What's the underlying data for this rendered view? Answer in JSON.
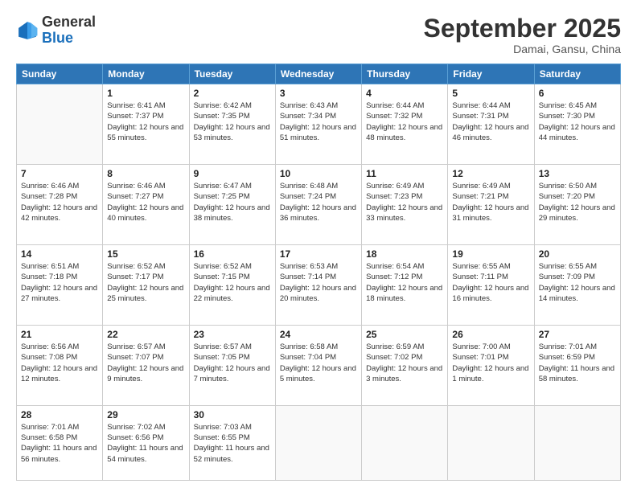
{
  "header": {
    "logo_general": "General",
    "logo_blue": "Blue",
    "month_title": "September 2025",
    "location": "Damai, Gansu, China"
  },
  "days_of_week": [
    "Sunday",
    "Monday",
    "Tuesday",
    "Wednesday",
    "Thursday",
    "Friday",
    "Saturday"
  ],
  "weeks": [
    [
      {
        "day": "",
        "empty": true
      },
      {
        "day": "1",
        "sunrise": "Sunrise: 6:41 AM",
        "sunset": "Sunset: 7:37 PM",
        "daylight": "Daylight: 12 hours and 55 minutes."
      },
      {
        "day": "2",
        "sunrise": "Sunrise: 6:42 AM",
        "sunset": "Sunset: 7:35 PM",
        "daylight": "Daylight: 12 hours and 53 minutes."
      },
      {
        "day": "3",
        "sunrise": "Sunrise: 6:43 AM",
        "sunset": "Sunset: 7:34 PM",
        "daylight": "Daylight: 12 hours and 51 minutes."
      },
      {
        "day": "4",
        "sunrise": "Sunrise: 6:44 AM",
        "sunset": "Sunset: 7:32 PM",
        "daylight": "Daylight: 12 hours and 48 minutes."
      },
      {
        "day": "5",
        "sunrise": "Sunrise: 6:44 AM",
        "sunset": "Sunset: 7:31 PM",
        "daylight": "Daylight: 12 hours and 46 minutes."
      },
      {
        "day": "6",
        "sunrise": "Sunrise: 6:45 AM",
        "sunset": "Sunset: 7:30 PM",
        "daylight": "Daylight: 12 hours and 44 minutes."
      }
    ],
    [
      {
        "day": "7",
        "sunrise": "Sunrise: 6:46 AM",
        "sunset": "Sunset: 7:28 PM",
        "daylight": "Daylight: 12 hours and 42 minutes."
      },
      {
        "day": "8",
        "sunrise": "Sunrise: 6:46 AM",
        "sunset": "Sunset: 7:27 PM",
        "daylight": "Daylight: 12 hours and 40 minutes."
      },
      {
        "day": "9",
        "sunrise": "Sunrise: 6:47 AM",
        "sunset": "Sunset: 7:25 PM",
        "daylight": "Daylight: 12 hours and 38 minutes."
      },
      {
        "day": "10",
        "sunrise": "Sunrise: 6:48 AM",
        "sunset": "Sunset: 7:24 PM",
        "daylight": "Daylight: 12 hours and 36 minutes."
      },
      {
        "day": "11",
        "sunrise": "Sunrise: 6:49 AM",
        "sunset": "Sunset: 7:23 PM",
        "daylight": "Daylight: 12 hours and 33 minutes."
      },
      {
        "day": "12",
        "sunrise": "Sunrise: 6:49 AM",
        "sunset": "Sunset: 7:21 PM",
        "daylight": "Daylight: 12 hours and 31 minutes."
      },
      {
        "day": "13",
        "sunrise": "Sunrise: 6:50 AM",
        "sunset": "Sunset: 7:20 PM",
        "daylight": "Daylight: 12 hours and 29 minutes."
      }
    ],
    [
      {
        "day": "14",
        "sunrise": "Sunrise: 6:51 AM",
        "sunset": "Sunset: 7:18 PM",
        "daylight": "Daylight: 12 hours and 27 minutes."
      },
      {
        "day": "15",
        "sunrise": "Sunrise: 6:52 AM",
        "sunset": "Sunset: 7:17 PM",
        "daylight": "Daylight: 12 hours and 25 minutes."
      },
      {
        "day": "16",
        "sunrise": "Sunrise: 6:52 AM",
        "sunset": "Sunset: 7:15 PM",
        "daylight": "Daylight: 12 hours and 22 minutes."
      },
      {
        "day": "17",
        "sunrise": "Sunrise: 6:53 AM",
        "sunset": "Sunset: 7:14 PM",
        "daylight": "Daylight: 12 hours and 20 minutes."
      },
      {
        "day": "18",
        "sunrise": "Sunrise: 6:54 AM",
        "sunset": "Sunset: 7:12 PM",
        "daylight": "Daylight: 12 hours and 18 minutes."
      },
      {
        "day": "19",
        "sunrise": "Sunrise: 6:55 AM",
        "sunset": "Sunset: 7:11 PM",
        "daylight": "Daylight: 12 hours and 16 minutes."
      },
      {
        "day": "20",
        "sunrise": "Sunrise: 6:55 AM",
        "sunset": "Sunset: 7:09 PM",
        "daylight": "Daylight: 12 hours and 14 minutes."
      }
    ],
    [
      {
        "day": "21",
        "sunrise": "Sunrise: 6:56 AM",
        "sunset": "Sunset: 7:08 PM",
        "daylight": "Daylight: 12 hours and 12 minutes."
      },
      {
        "day": "22",
        "sunrise": "Sunrise: 6:57 AM",
        "sunset": "Sunset: 7:07 PM",
        "daylight": "Daylight: 12 hours and 9 minutes."
      },
      {
        "day": "23",
        "sunrise": "Sunrise: 6:57 AM",
        "sunset": "Sunset: 7:05 PM",
        "daylight": "Daylight: 12 hours and 7 minutes."
      },
      {
        "day": "24",
        "sunrise": "Sunrise: 6:58 AM",
        "sunset": "Sunset: 7:04 PM",
        "daylight": "Daylight: 12 hours and 5 minutes."
      },
      {
        "day": "25",
        "sunrise": "Sunrise: 6:59 AM",
        "sunset": "Sunset: 7:02 PM",
        "daylight": "Daylight: 12 hours and 3 minutes."
      },
      {
        "day": "26",
        "sunrise": "Sunrise: 7:00 AM",
        "sunset": "Sunset: 7:01 PM",
        "daylight": "Daylight: 12 hours and 1 minute."
      },
      {
        "day": "27",
        "sunrise": "Sunrise: 7:01 AM",
        "sunset": "Sunset: 6:59 PM",
        "daylight": "Daylight: 11 hours and 58 minutes."
      }
    ],
    [
      {
        "day": "28",
        "sunrise": "Sunrise: 7:01 AM",
        "sunset": "Sunset: 6:58 PM",
        "daylight": "Daylight: 11 hours and 56 minutes."
      },
      {
        "day": "29",
        "sunrise": "Sunrise: 7:02 AM",
        "sunset": "Sunset: 6:56 PM",
        "daylight": "Daylight: 11 hours and 54 minutes."
      },
      {
        "day": "30",
        "sunrise": "Sunrise: 7:03 AM",
        "sunset": "Sunset: 6:55 PM",
        "daylight": "Daylight: 11 hours and 52 minutes."
      },
      {
        "day": "",
        "empty": true
      },
      {
        "day": "",
        "empty": true
      },
      {
        "day": "",
        "empty": true
      },
      {
        "day": "",
        "empty": true
      }
    ]
  ]
}
